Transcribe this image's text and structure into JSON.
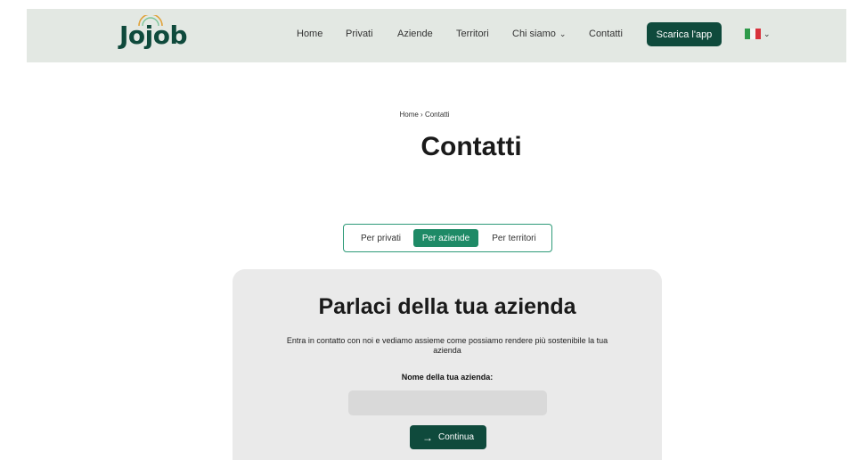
{
  "header": {
    "logo_text": "Jojob",
    "nav": [
      {
        "label": "Home"
      },
      {
        "label": "Privati"
      },
      {
        "label": "Aziende"
      },
      {
        "label": "Territori"
      },
      {
        "label": "Chi siamo",
        "has_dropdown": true
      },
      {
        "label": "Contatti"
      }
    ],
    "cta_label": "Scarica l'app",
    "language": "it",
    "colors": {
      "brand": "#0f4a3c",
      "header_bg": "#e3e8e3"
    }
  },
  "breadcrumb": {
    "home": "Home",
    "separator": "›",
    "current": "Contatti"
  },
  "page_title": "Contatti",
  "tabs": [
    {
      "label": "Per privati",
      "active": false
    },
    {
      "label": "Per aziende",
      "active": true
    },
    {
      "label": "Per territori",
      "active": false
    }
  ],
  "form": {
    "title": "Parlaci della tua azienda",
    "description": "Entra in contatto con noi e vediamo assieme come possiamo rendere più sostenibile la tua azienda",
    "field_label": "Nome della tua azienda:",
    "field_value": "",
    "field_placeholder": "",
    "submit_label": "Continua",
    "submit_icon": "arrow-right-icon",
    "colors": {
      "accent": "#1e8a66"
    }
  }
}
